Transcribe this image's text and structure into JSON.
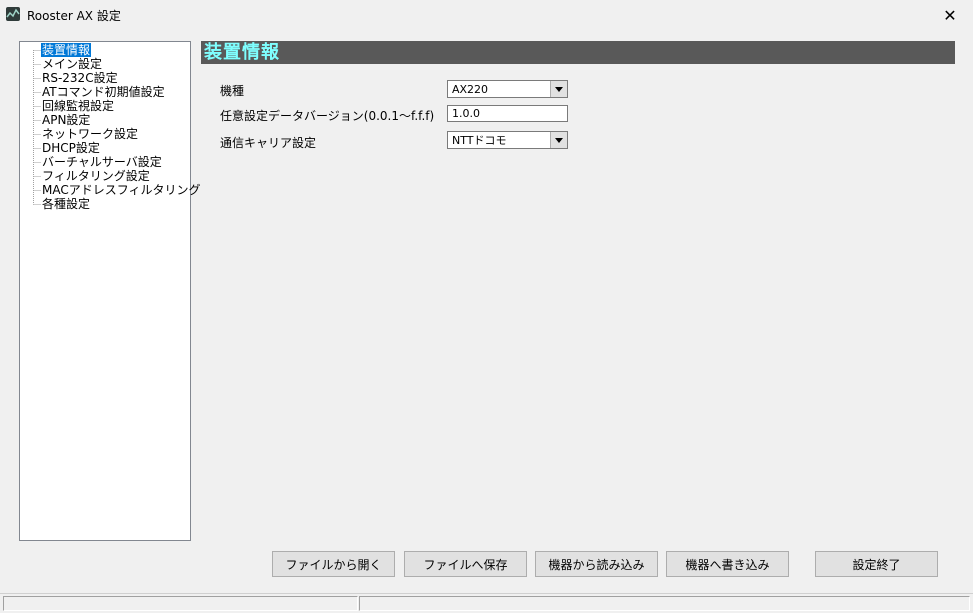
{
  "window": {
    "title": "Rooster AX 設定",
    "close_glyph": "✕"
  },
  "tree": {
    "items": [
      {
        "label": "装置情報",
        "selected": true
      },
      {
        "label": "メイン設定"
      },
      {
        "label": "RS-232C設定"
      },
      {
        "label": "ATコマンド初期値設定"
      },
      {
        "label": "回線監視設定"
      },
      {
        "label": "APN設定"
      },
      {
        "label": "ネットワーク設定"
      },
      {
        "label": "DHCP設定"
      },
      {
        "label": "バーチャルサーバ設定"
      },
      {
        "label": "フィルタリング設定"
      },
      {
        "label": "MACアドレスフィルタリング"
      },
      {
        "label": "各種設定"
      }
    ]
  },
  "panel": {
    "title": "装置情報",
    "title_color": "#7fffff",
    "header_bg": "#595959"
  },
  "form": {
    "model_label": "機種",
    "model_value": "AX220",
    "data_version_label": "任意設定データバージョン(0.0.1～f.f.f)",
    "data_version_value": "1.0.0",
    "carrier_label": "通信キャリア設定",
    "carrier_value": "NTTドコモ"
  },
  "buttons": {
    "open_file": "ファイルから開く",
    "save_file": "ファイルへ保存",
    "read_device": "機器から読み込み",
    "write_device": "機器へ書き込み",
    "finish": "設定終了"
  },
  "colors": {
    "selection": "#0078d7",
    "window_bg": "#f0f0f0"
  }
}
